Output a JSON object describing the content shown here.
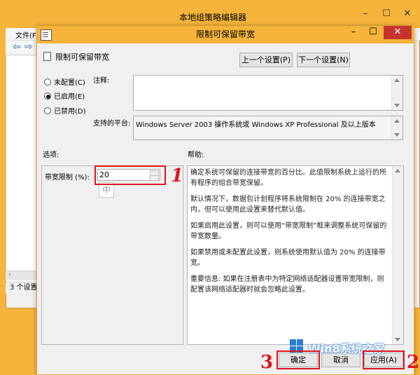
{
  "main_window": {
    "title": "本地组策略编辑器",
    "menu_file": "文件(F)",
    "status": "3 个设置"
  },
  "dialog": {
    "title": "限制可保留带宽",
    "policy_name": "限制可保留带宽",
    "prev_button": "上一个设置(P)",
    "next_button": "下一个设置(N)",
    "radio_not_configured": "未配置(C)",
    "radio_enabled": "已启用(E)",
    "radio_disabled": "已禁用(D)",
    "selected_state": "已启用(E)",
    "comment_label": "注释:",
    "comment_value": "",
    "platform_label": "支持的平台:",
    "platform_value": "Windows Server 2003 操作系统或 Windows XP Professional 及以上版本",
    "options_label": "选项:",
    "help_label": "帮助:",
    "bandwidth_label": "带宽限制 (%):",
    "bandwidth_value": "20",
    "ime_indicator": "中",
    "help_paragraphs": [
      "确定系统可保留的连接带宽的百分比。此值限制系统上运行的所有程序的组合带宽保留。",
      "默认情况下，数据包计划程序将系统限制在 20% 的连接带宽之内，但可以使用此设置来替代默认值。",
      "如果启用此设置，则可以使用“带宽限制”框来调整系统可保留的带宽数量。",
      "如果禁用或未配置此设置，则系统使用默认值为 20% 的连接带宽。",
      "重要信息: 如果在注册表中为特定网络适配器设置带宽限制，则配置该网络适配器时就会忽略此设置。"
    ],
    "ok_button": "确定",
    "cancel_button": "取消",
    "apply_button": "应用(A)"
  },
  "annotations": {
    "step1": "1",
    "step2": "2",
    "step3": "3",
    "color": "#e0141c"
  },
  "watermark": {
    "text": "Win8系统之家"
  },
  "colors": {
    "title_bar": "#f6b43a",
    "close_button": "#c7342e"
  }
}
